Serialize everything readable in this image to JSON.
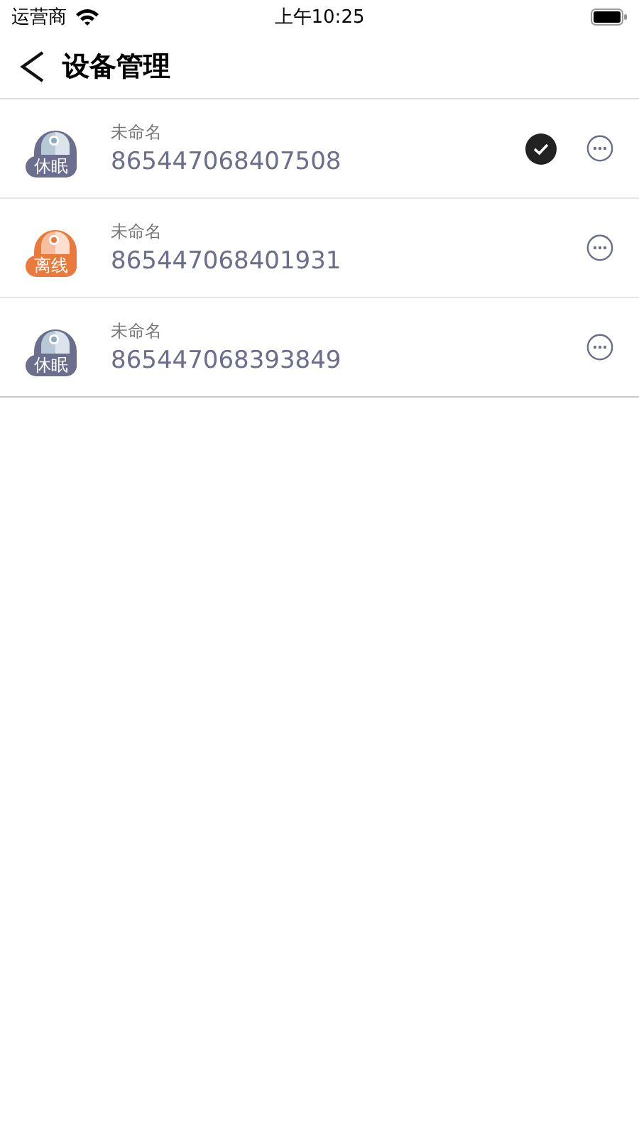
{
  "status_bar": {
    "carrier": "运营商",
    "time": "上午10:25"
  },
  "header": {
    "title": "设备管理"
  },
  "devices": [
    {
      "name": "未命名",
      "id": "865447068407508",
      "kind": "sleep",
      "status_label": "休眠",
      "selected": true
    },
    {
      "name": "未命名",
      "id": "865447068401931",
      "kind": "offline",
      "status_label": "离线",
      "selected": false
    },
    {
      "name": "未命名",
      "id": "865447068393849",
      "kind": "sleep",
      "status_label": "休眠",
      "selected": false
    }
  ]
}
